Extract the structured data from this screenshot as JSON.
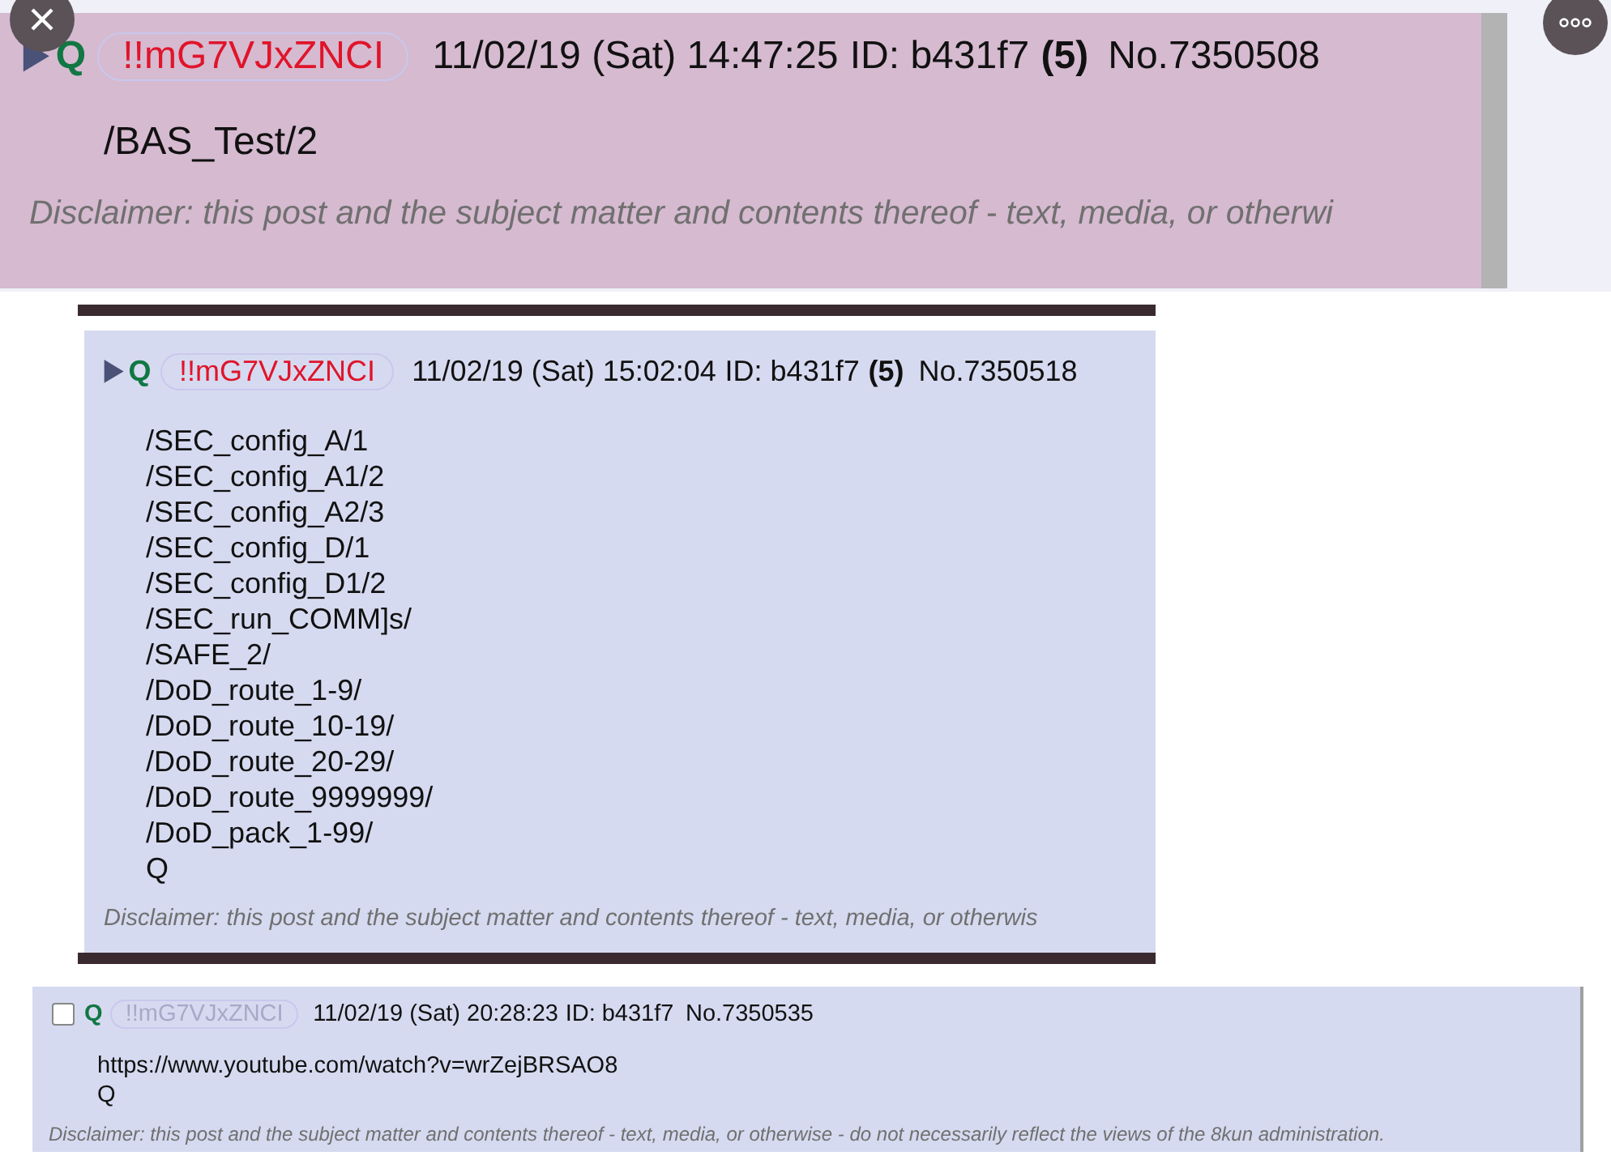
{
  "posts": [
    {
      "kind": "arrow",
      "highlighted": true,
      "trip_faded": false,
      "q": "Q",
      "tripcode": "!!mG7VJxZNCI",
      "datetime": "11/02/19 (Sat) 14:47:25",
      "id": "ID: b431f7",
      "count": "(5)",
      "number": "No.7350508",
      "lines": [
        "/BAS_Test/2"
      ],
      "disclaimer": "Disclaimer: this post and the subject matter and contents thereof - text, media, or otherwi"
    },
    {
      "kind": "arrow",
      "highlighted": false,
      "trip_faded": false,
      "q": "Q",
      "tripcode": "!!mG7VJxZNCI",
      "datetime": "11/02/19 (Sat) 15:02:04",
      "id": "ID: b431f7",
      "count": "(5)",
      "number": "No.7350518",
      "lines": [
        "/SEC_config_A/1",
        "/SEC_config_A1/2",
        "/SEC_config_A2/3",
        "/SEC_config_D/1",
        "/SEC_config_D1/2",
        "/SEC_run_COMM]s/",
        "/SAFE_2/",
        "/DoD_route_1-9/",
        "/DoD_route_10-19/",
        "/DoD_route_20-29/",
        "/DoD_route_9999999/",
        "/DoD_pack_1-99/",
        "Q"
      ],
      "disclaimer": "Disclaimer: this post and the subject matter and contents thereof - text, media, or otherwis"
    },
    {
      "kind": "checkbox",
      "checked": false,
      "highlighted": false,
      "trip_faded": true,
      "q": "Q",
      "tripcode": "!!mG7VJxZNCI",
      "datetime": "11/02/19 (Sat) 20:28:23",
      "id": "ID: b431f7",
      "number": "No.7350535",
      "lines": [
        "https://www.youtube.com/watch?v=wrZejBRSAO8",
        "Q"
      ],
      "disclaimer": "Disclaimer: this post and the subject matter and contents thereof - text, media, or otherwise - do not necessarily reflect the views of the 8kun administration."
    }
  ]
}
